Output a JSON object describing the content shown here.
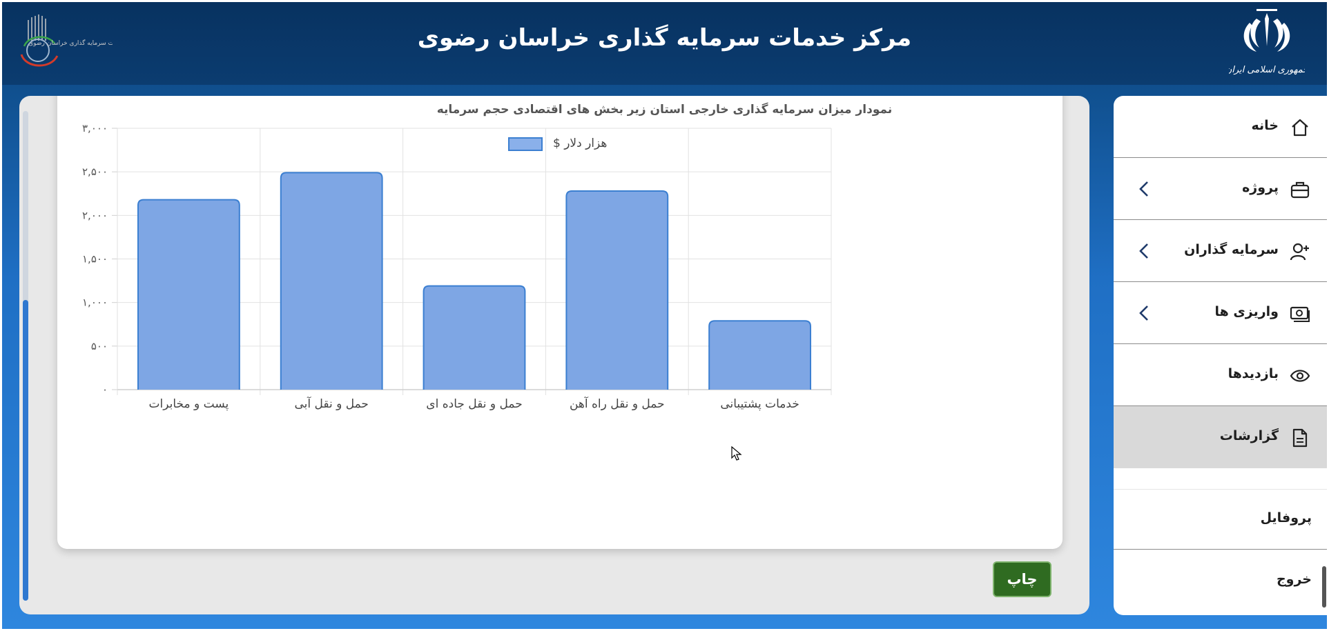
{
  "header": {
    "title": "مرکز خدمات سرمایه گذاری خراسان رضوی",
    "emblem_caption": "جمهوری اسلامی ایران",
    "logo_caption": "مرکز خدمات سرمایه گذاری خراسان رضوی"
  },
  "sidebar": {
    "items": [
      {
        "label": "خانه",
        "icon": "home-icon",
        "has_submenu": false
      },
      {
        "label": "پروژه",
        "icon": "briefcase-icon",
        "has_submenu": true
      },
      {
        "label": "سرمایه گذاران",
        "icon": "add-user-icon",
        "has_submenu": true
      },
      {
        "label": "واریزی ها",
        "icon": "money-icon",
        "has_submenu": true
      },
      {
        "label": "بازدیدها",
        "icon": "eye-icon",
        "has_submenu": false
      },
      {
        "label": "گزارشات",
        "icon": "document-icon",
        "has_submenu": false,
        "active": true
      }
    ],
    "profile_label": "پروفایل",
    "logout_label": "خروج"
  },
  "print_button": {
    "label": "چاپ"
  },
  "colors": {
    "header_bg": "#0b3c70",
    "bar_fill": "#7ea6e4",
    "bar_stroke": "#3b7fd1",
    "print_button": "#2f6b21"
  },
  "chart_data": {
    "type": "bar",
    "title": "نمودار میزان سرمایه گذاری خارجی استان زیر بخش های اقتصادی حجم سرمایه",
    "categories": [
      "پست و مخابرات",
      "حمل و نقل آبی",
      "حمل و نقل جاده ای",
      "حمل و نقل راه آهن",
      "خدمات پشتیبانی"
    ],
    "series": [
      {
        "name": "هزار دلار $",
        "values": [
          2180,
          2490,
          1190,
          2280,
          790
        ]
      }
    ],
    "ylim": [
      0,
      3000
    ],
    "yticks": [
      "۰",
      "۵۰۰",
      "۱,۰۰۰",
      "۱,۵۰۰",
      "۲,۰۰۰",
      "۲,۵۰۰",
      "۳,۰۰۰"
    ],
    "ytick_values": [
      0,
      500,
      1000,
      1500,
      2000,
      2500,
      3000
    ],
    "grid": true,
    "legend": "top-center"
  }
}
